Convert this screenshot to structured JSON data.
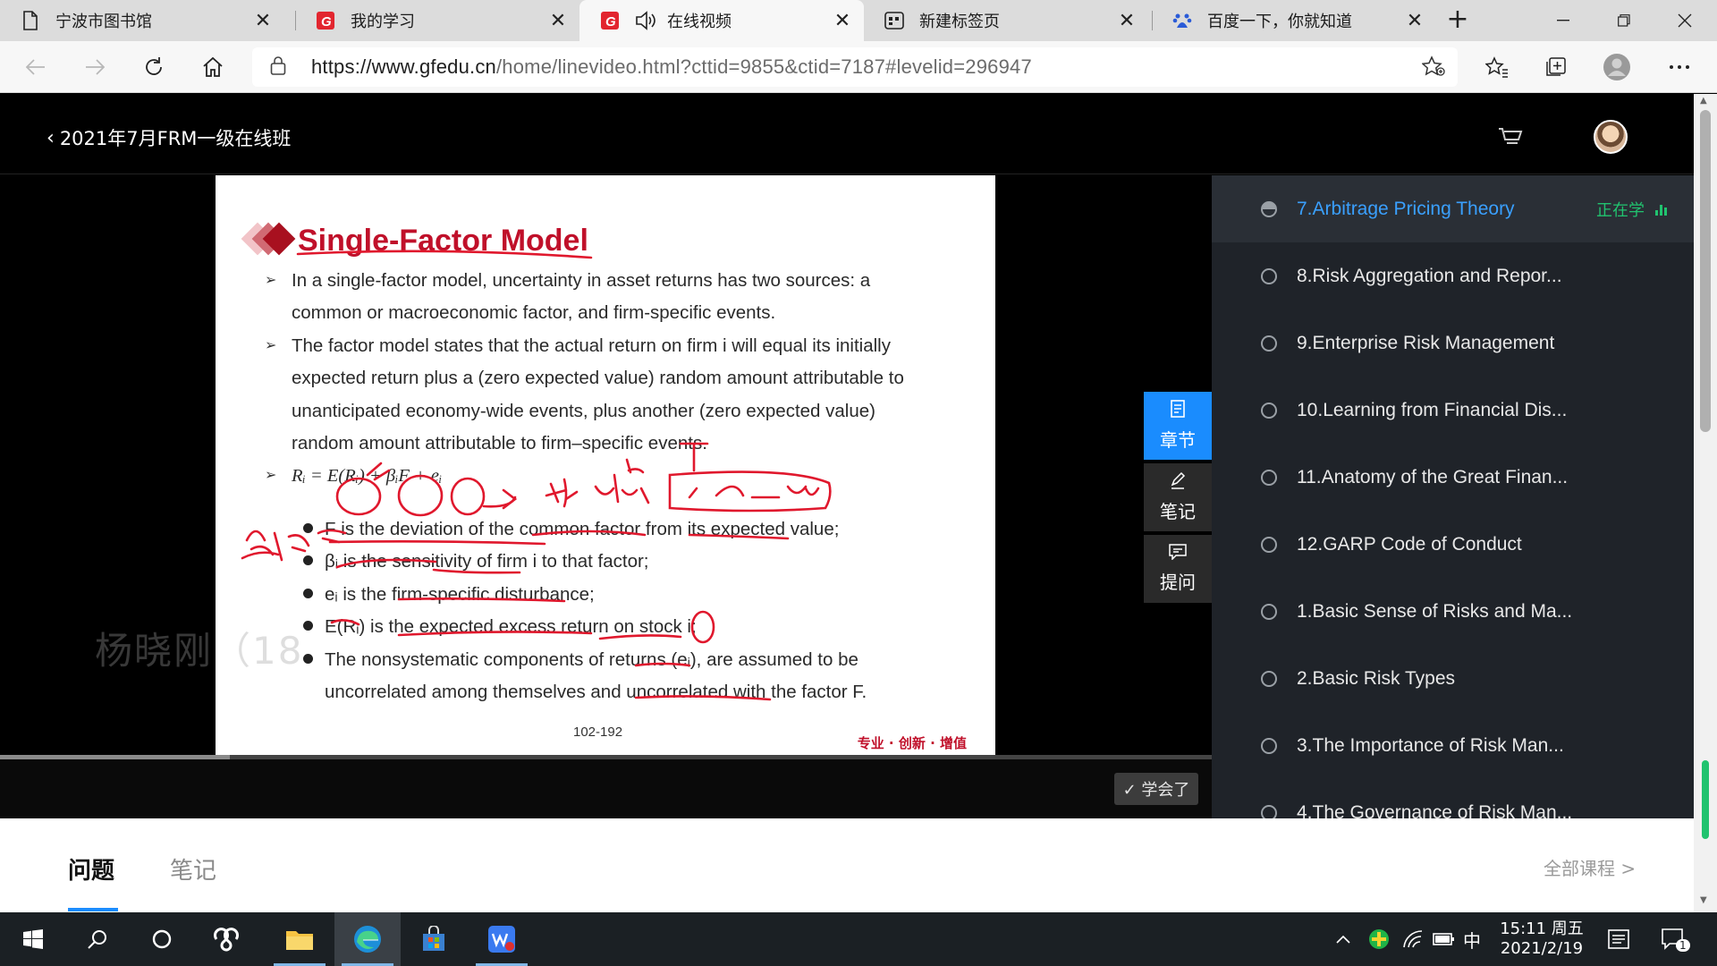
{
  "browser": {
    "tabs": [
      {
        "label": "宁波市图书馆",
        "icon": "page-icon"
      },
      {
        "label": "我的学习",
        "icon": "gfedu-icon"
      },
      {
        "label": "在线视频",
        "icon": "gfedu-icon",
        "audio": "speaker-icon"
      },
      {
        "label": "新建标签页",
        "icon": "newtab-icon"
      },
      {
        "label": "百度一下，你就知道",
        "icon": "baidu-icon"
      }
    ],
    "close_glyph": "✕",
    "new_tab_glyph": "+",
    "url_main": "https://www.gfedu.cn",
    "url_rest": "/home/linevideo.html?cttid=9855&ctid=7187#levelid=296947"
  },
  "header": {
    "course_title": "2021年7月FRM一级在线班"
  },
  "slide": {
    "title": "Single-Factor Model",
    "bullets": [
      "In a single-factor model, uncertainty in asset returns has two sources: a",
      "common or macroeconomic factor, and firm-specific events.",
      "The factor model states that the actual return on firm i will equal its initially",
      "expected return plus a (zero expected value) random amount attributable to",
      "unanticipated economy-wide events, plus another (zero expected value)",
      "random amount attributable to firm–specific events."
    ],
    "formula": "Rᵢ = E(Rᵢ) + βᵢF + eᵢ",
    "sub_bullets": [
      "F is the deviation of the common factor from its expected value;",
      "βᵢ is the sensitivity of firm i to that factor;",
      "eᵢ is the firm-specific disturbance;",
      "E(Rᵢ) is the expected excess return on stock i;",
      "The nonsystematic components of returns (eᵢ), are assumed to be",
      "uncorrelated among themselves and uncorrelated with the factor F."
    ],
    "page": "102-192",
    "slogan": "专业 · 创新 · 增值",
    "watermark": "杨晓刚（18"
  },
  "side_tools": [
    {
      "label": "章节",
      "icon": "chapter-icon"
    },
    {
      "label": "笔记",
      "icon": "note-icon"
    },
    {
      "label": "提问",
      "icon": "question-icon"
    }
  ],
  "player": {
    "learned_label": "✓ 学会了",
    "progress": 0.19
  },
  "chapters": [
    {
      "label": "7.Arbitrage Pricing Theory",
      "current": true
    },
    {
      "label": "8.Risk Aggregation and Repor..."
    },
    {
      "label": "9.Enterprise Risk Management"
    },
    {
      "label": "10.Learning from Financial Dis..."
    },
    {
      "label": "11.Anatomy of the Great Finan..."
    },
    {
      "label": "12.GARP Code of Conduct"
    },
    {
      "label": "1.Basic Sense of Risks and Ma..."
    },
    {
      "label": "2.Basic Risk Types"
    },
    {
      "label": "3.The Importance of Risk Man..."
    },
    {
      "label": "4.The Governance of Risk Man..."
    }
  ],
  "now_learning": "正在学",
  "bottom_tabs": {
    "questions": "问题",
    "notes": "笔记",
    "all_courses": "全部课程 >"
  },
  "taskbar": {
    "time": "15:11 周五",
    "date": "2021/2/19",
    "ime": "中",
    "notif_count": "1"
  }
}
